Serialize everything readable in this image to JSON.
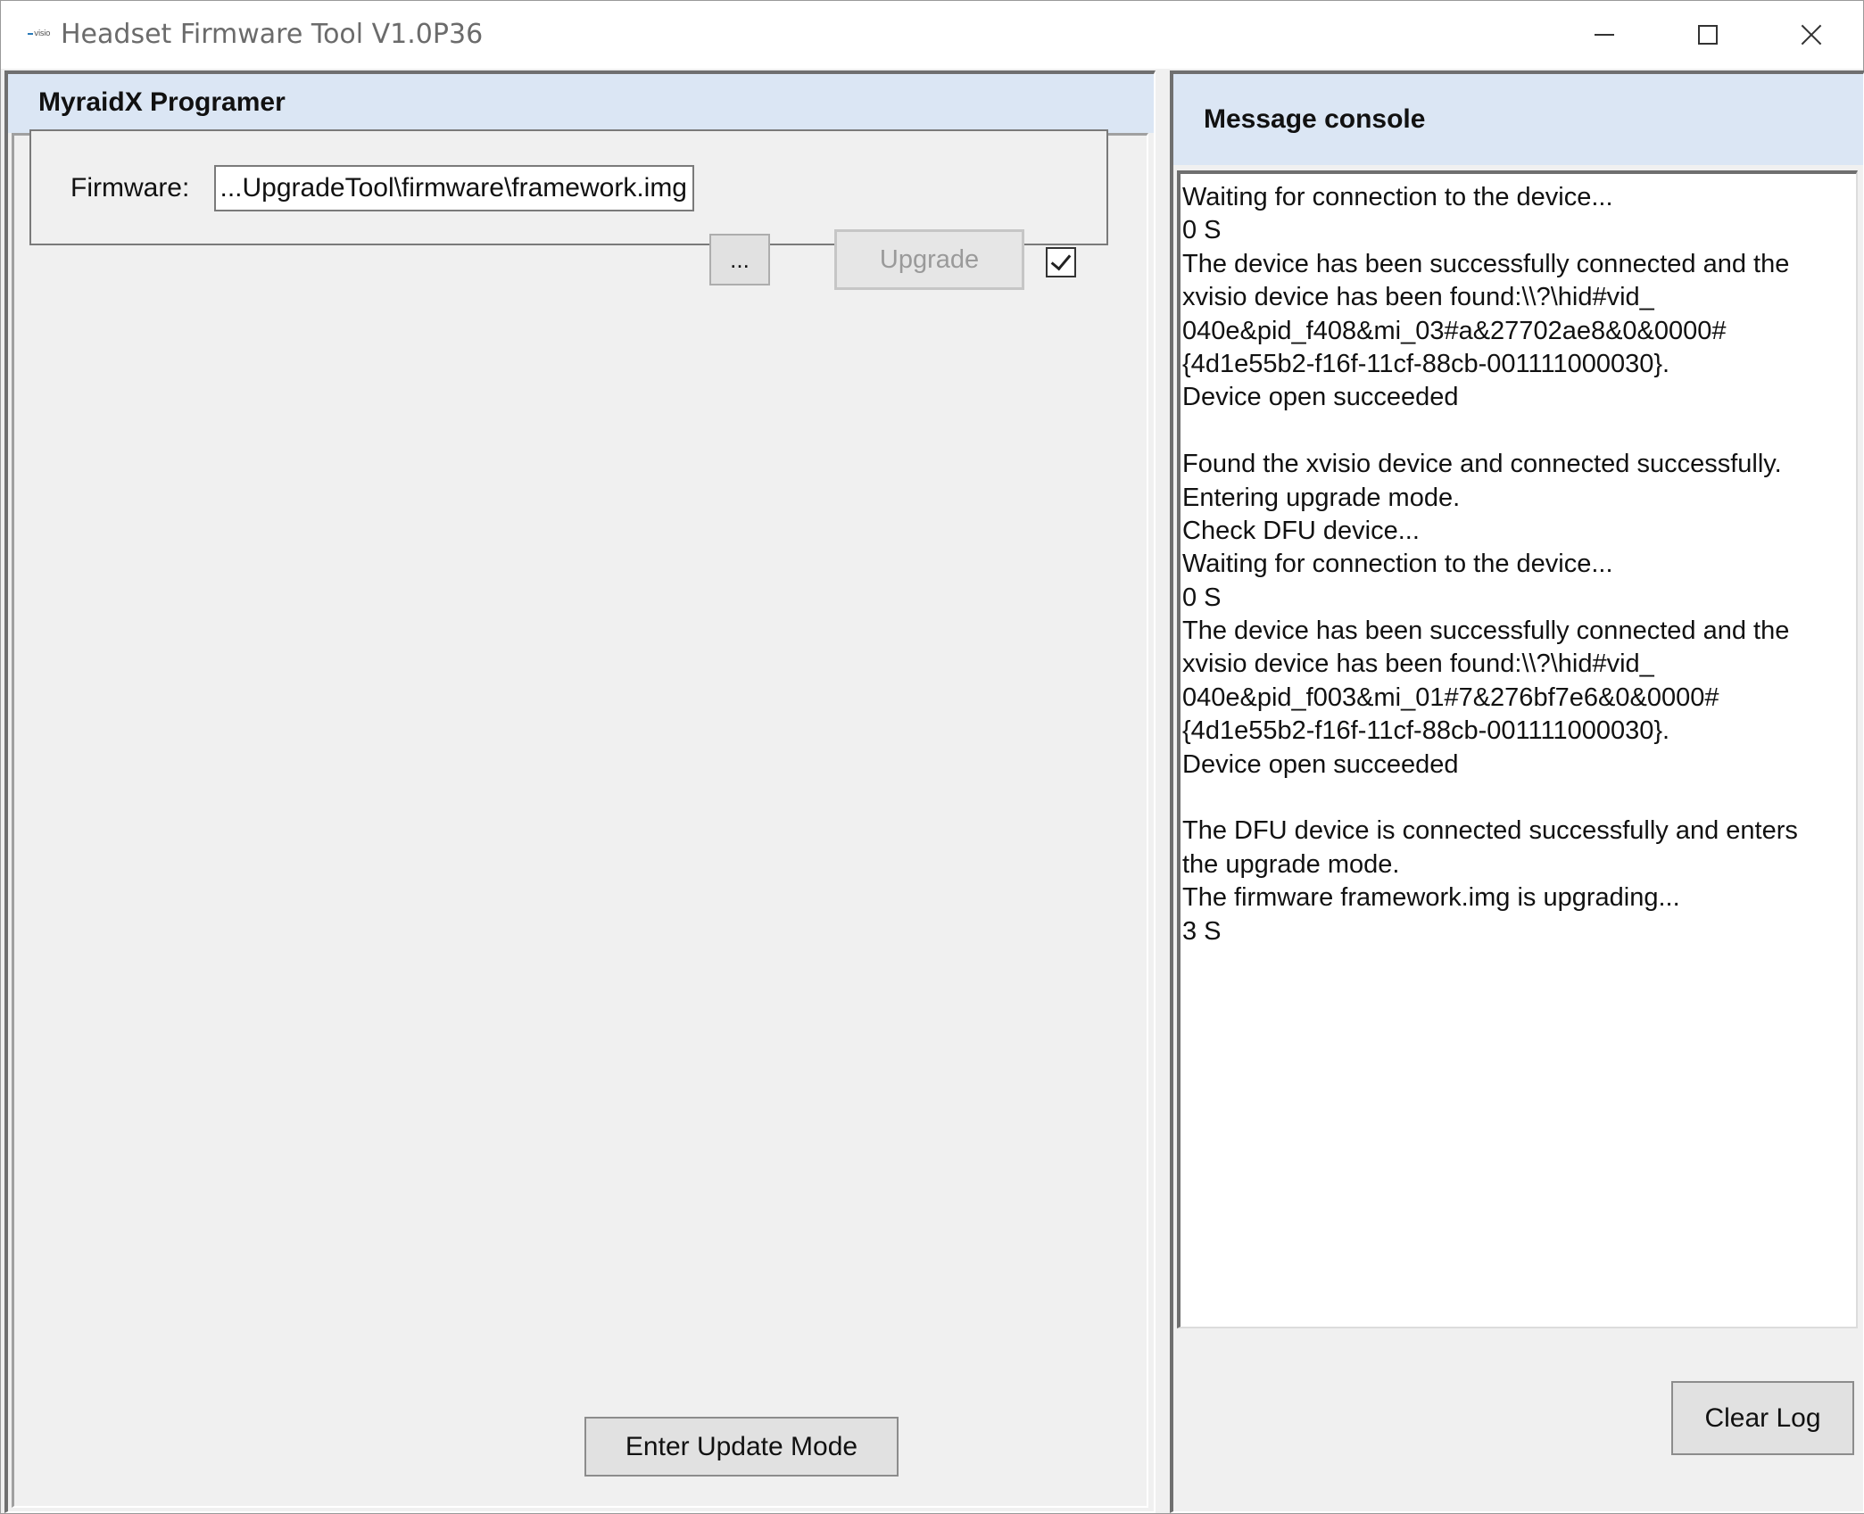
{
  "window": {
    "title": "Headset Firmware Tool V1.0P36",
    "icon": "xvisio-logo-icon",
    "controls": [
      "minimize-icon",
      "maximize-icon",
      "close-icon"
    ]
  },
  "left_panel": {
    "header": "MyraidX Programer",
    "firmware": {
      "label": "Firmware:",
      "value": "...UpgradeTool\\firmware\\framework.img",
      "browse_label": "...",
      "upgrade_label": "Upgrade",
      "upgrade_enabled": false,
      "checkbox_checked": true
    },
    "enter_update_label": "Enter Update Mode"
  },
  "right_panel": {
    "header": "Message console",
    "lines": [
      "Waiting for connection to the device...",
      "0 S",
      "The device has been successfully connected and the",
      "xvisio device has been found:\\\\?\\hid#vid_",
      "040e&pid_f408&mi_03#a&27702ae8&0&0000#",
      "{4d1e55b2-f16f-11cf-88cb-001111000030}.",
      "Device open succeeded",
      "",
      "Found the xvisio device and connected successfully.",
      "Entering upgrade mode.",
      "Check DFU device...",
      "Waiting for connection to the device...",
      "0 S",
      "The device has been successfully connected and the",
      "xvisio device has been found:\\\\?\\hid#vid_",
      "040e&pid_f003&mi_01#7&276bf7e6&0&0000#",
      "{4d1e55b2-f16f-11cf-88cb-001111000030}.",
      "Device open succeeded",
      "",
      "The DFU device is connected successfully and enters",
      "the upgrade mode.",
      "The firmware framework.img is upgrading...",
      "3 S"
    ],
    "clear_label": "Clear Log"
  }
}
